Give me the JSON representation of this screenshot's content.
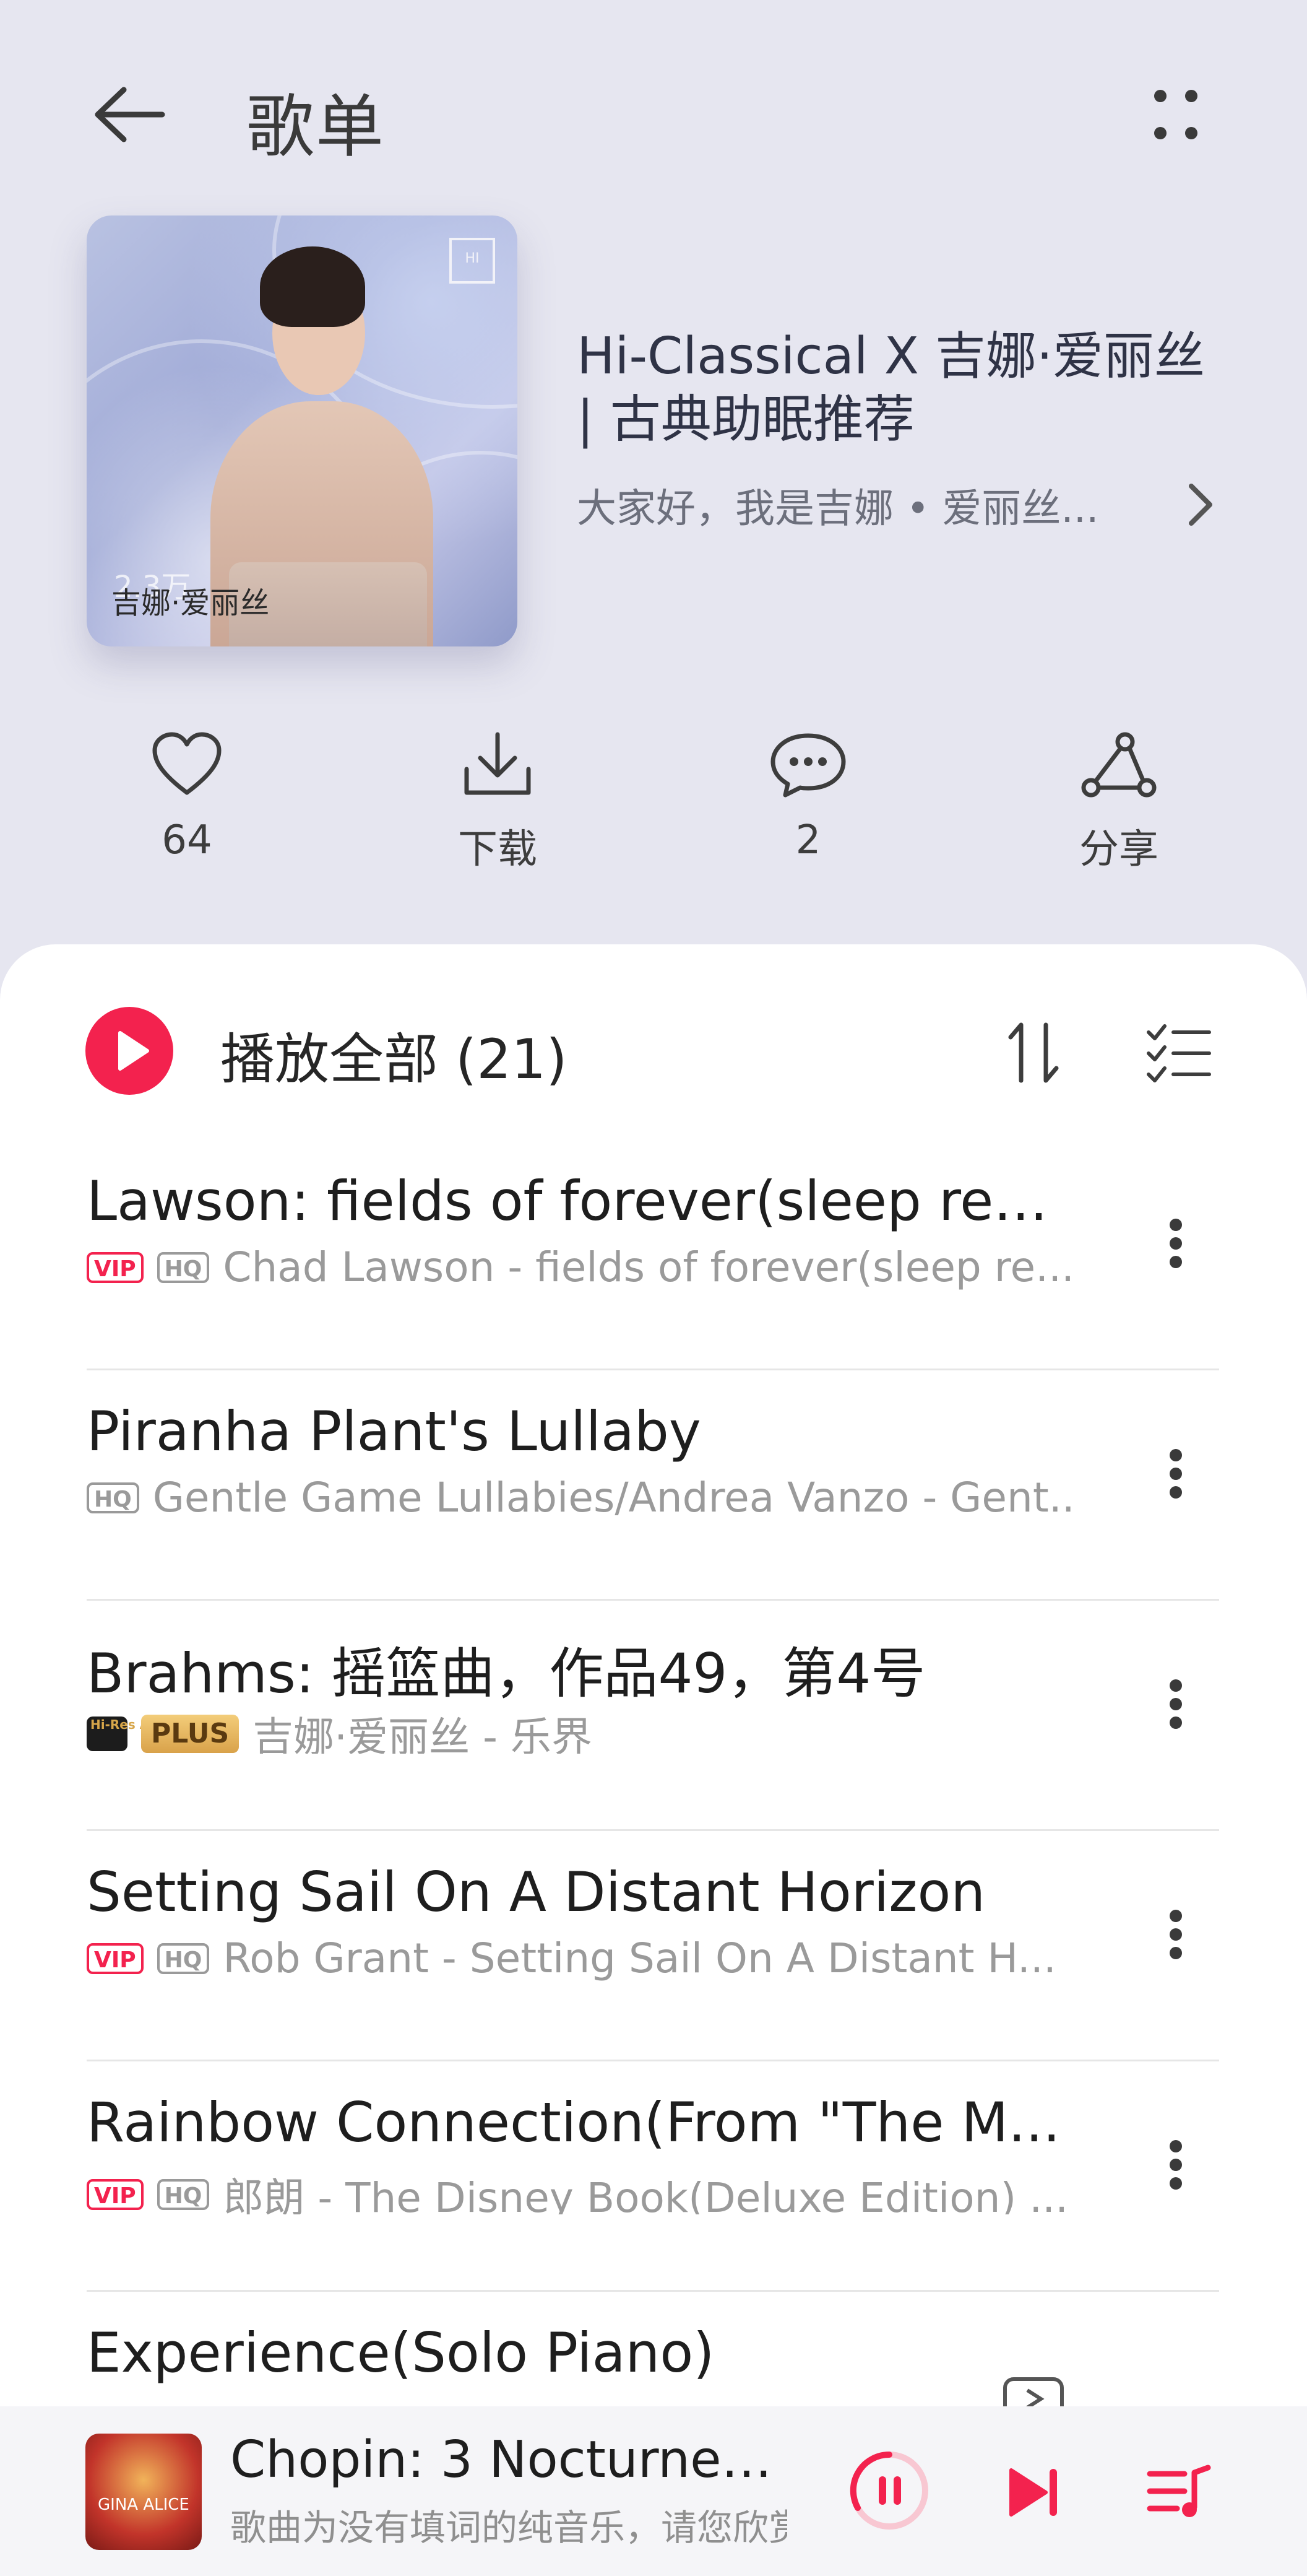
{
  "header": {
    "title": "歌单"
  },
  "playlist": {
    "cover_label": "吉娜·爱丽丝",
    "play_count": "2.3万",
    "title": "Hi-Classical X 吉娜·爱丽丝 | 古典助眠推荐",
    "description": "大家好，我是吉娜 • 爱丽丝..."
  },
  "actions": {
    "like_count": "64",
    "download_label": "下载",
    "comment_count": "2",
    "share_label": "分享"
  },
  "list": {
    "play_all_label": "播放全部 (21)",
    "songs": [
      {
        "title": "Lawson: fields of forever(sleep rew...",
        "subtitle": "Chad Lawson - fields of forever(sleep re...",
        "badges": [
          "VIP",
          "HQ"
        ]
      },
      {
        "title": "Piranha Plant's Lullaby",
        "subtitle": "Gentle Game Lullabies/Andrea Vanzo - Gent...",
        "badges": [
          "HQ"
        ]
      },
      {
        "title": "Brahms: 摇篮曲，作品49，第4号",
        "subtitle": "吉娜·爱丽丝 - 乐界",
        "badges": [
          "Hi-Res AUDIO",
          "PLUS"
        ]
      },
      {
        "title": "Setting Sail On A Distant Horizon",
        "subtitle": "Rob Grant - Setting Sail On A Distant H...",
        "badges": [
          "VIP",
          "HQ"
        ]
      },
      {
        "title": "Rainbow Connection(From \"The M...",
        "subtitle": "郎朗 - The Disney Book(Deluxe Edition) ...",
        "badges": [
          "VIP",
          "HQ"
        ]
      },
      {
        "title": "Experience(Solo Piano)",
        "subtitle": "",
        "badges": []
      }
    ]
  },
  "player": {
    "title": "Chopin: 3 Nocturnes,...",
    "subtitle": "歌曲为没有填词的纯音乐，请您欣赏",
    "cover_text": "GINA ALICE"
  },
  "colors": {
    "accent": "#f3224e",
    "background": "#e6e6f0"
  }
}
